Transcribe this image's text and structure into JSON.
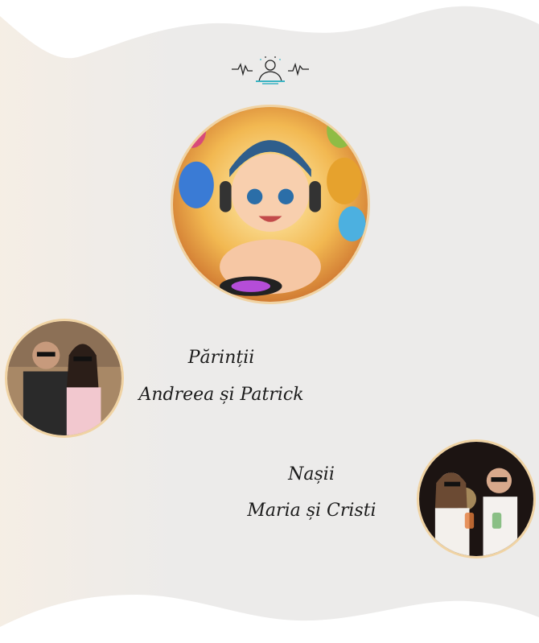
{
  "logo": {
    "icon": "dj-icon"
  },
  "images": {
    "main": "dj-baby-illustration",
    "parents": "parents-photo",
    "godparents": "godparents-photo"
  },
  "parents": {
    "title": "Părinții",
    "names": "Andreea și Patrick"
  },
  "godparents": {
    "title": "Nașii",
    "names": "Maria și Cristi"
  },
  "colors": {
    "background": "#ecebea",
    "wave": "#ffffff",
    "frame": "#f0d3a3",
    "text": "#1b1b1b",
    "accent": "#3bb3c3"
  }
}
